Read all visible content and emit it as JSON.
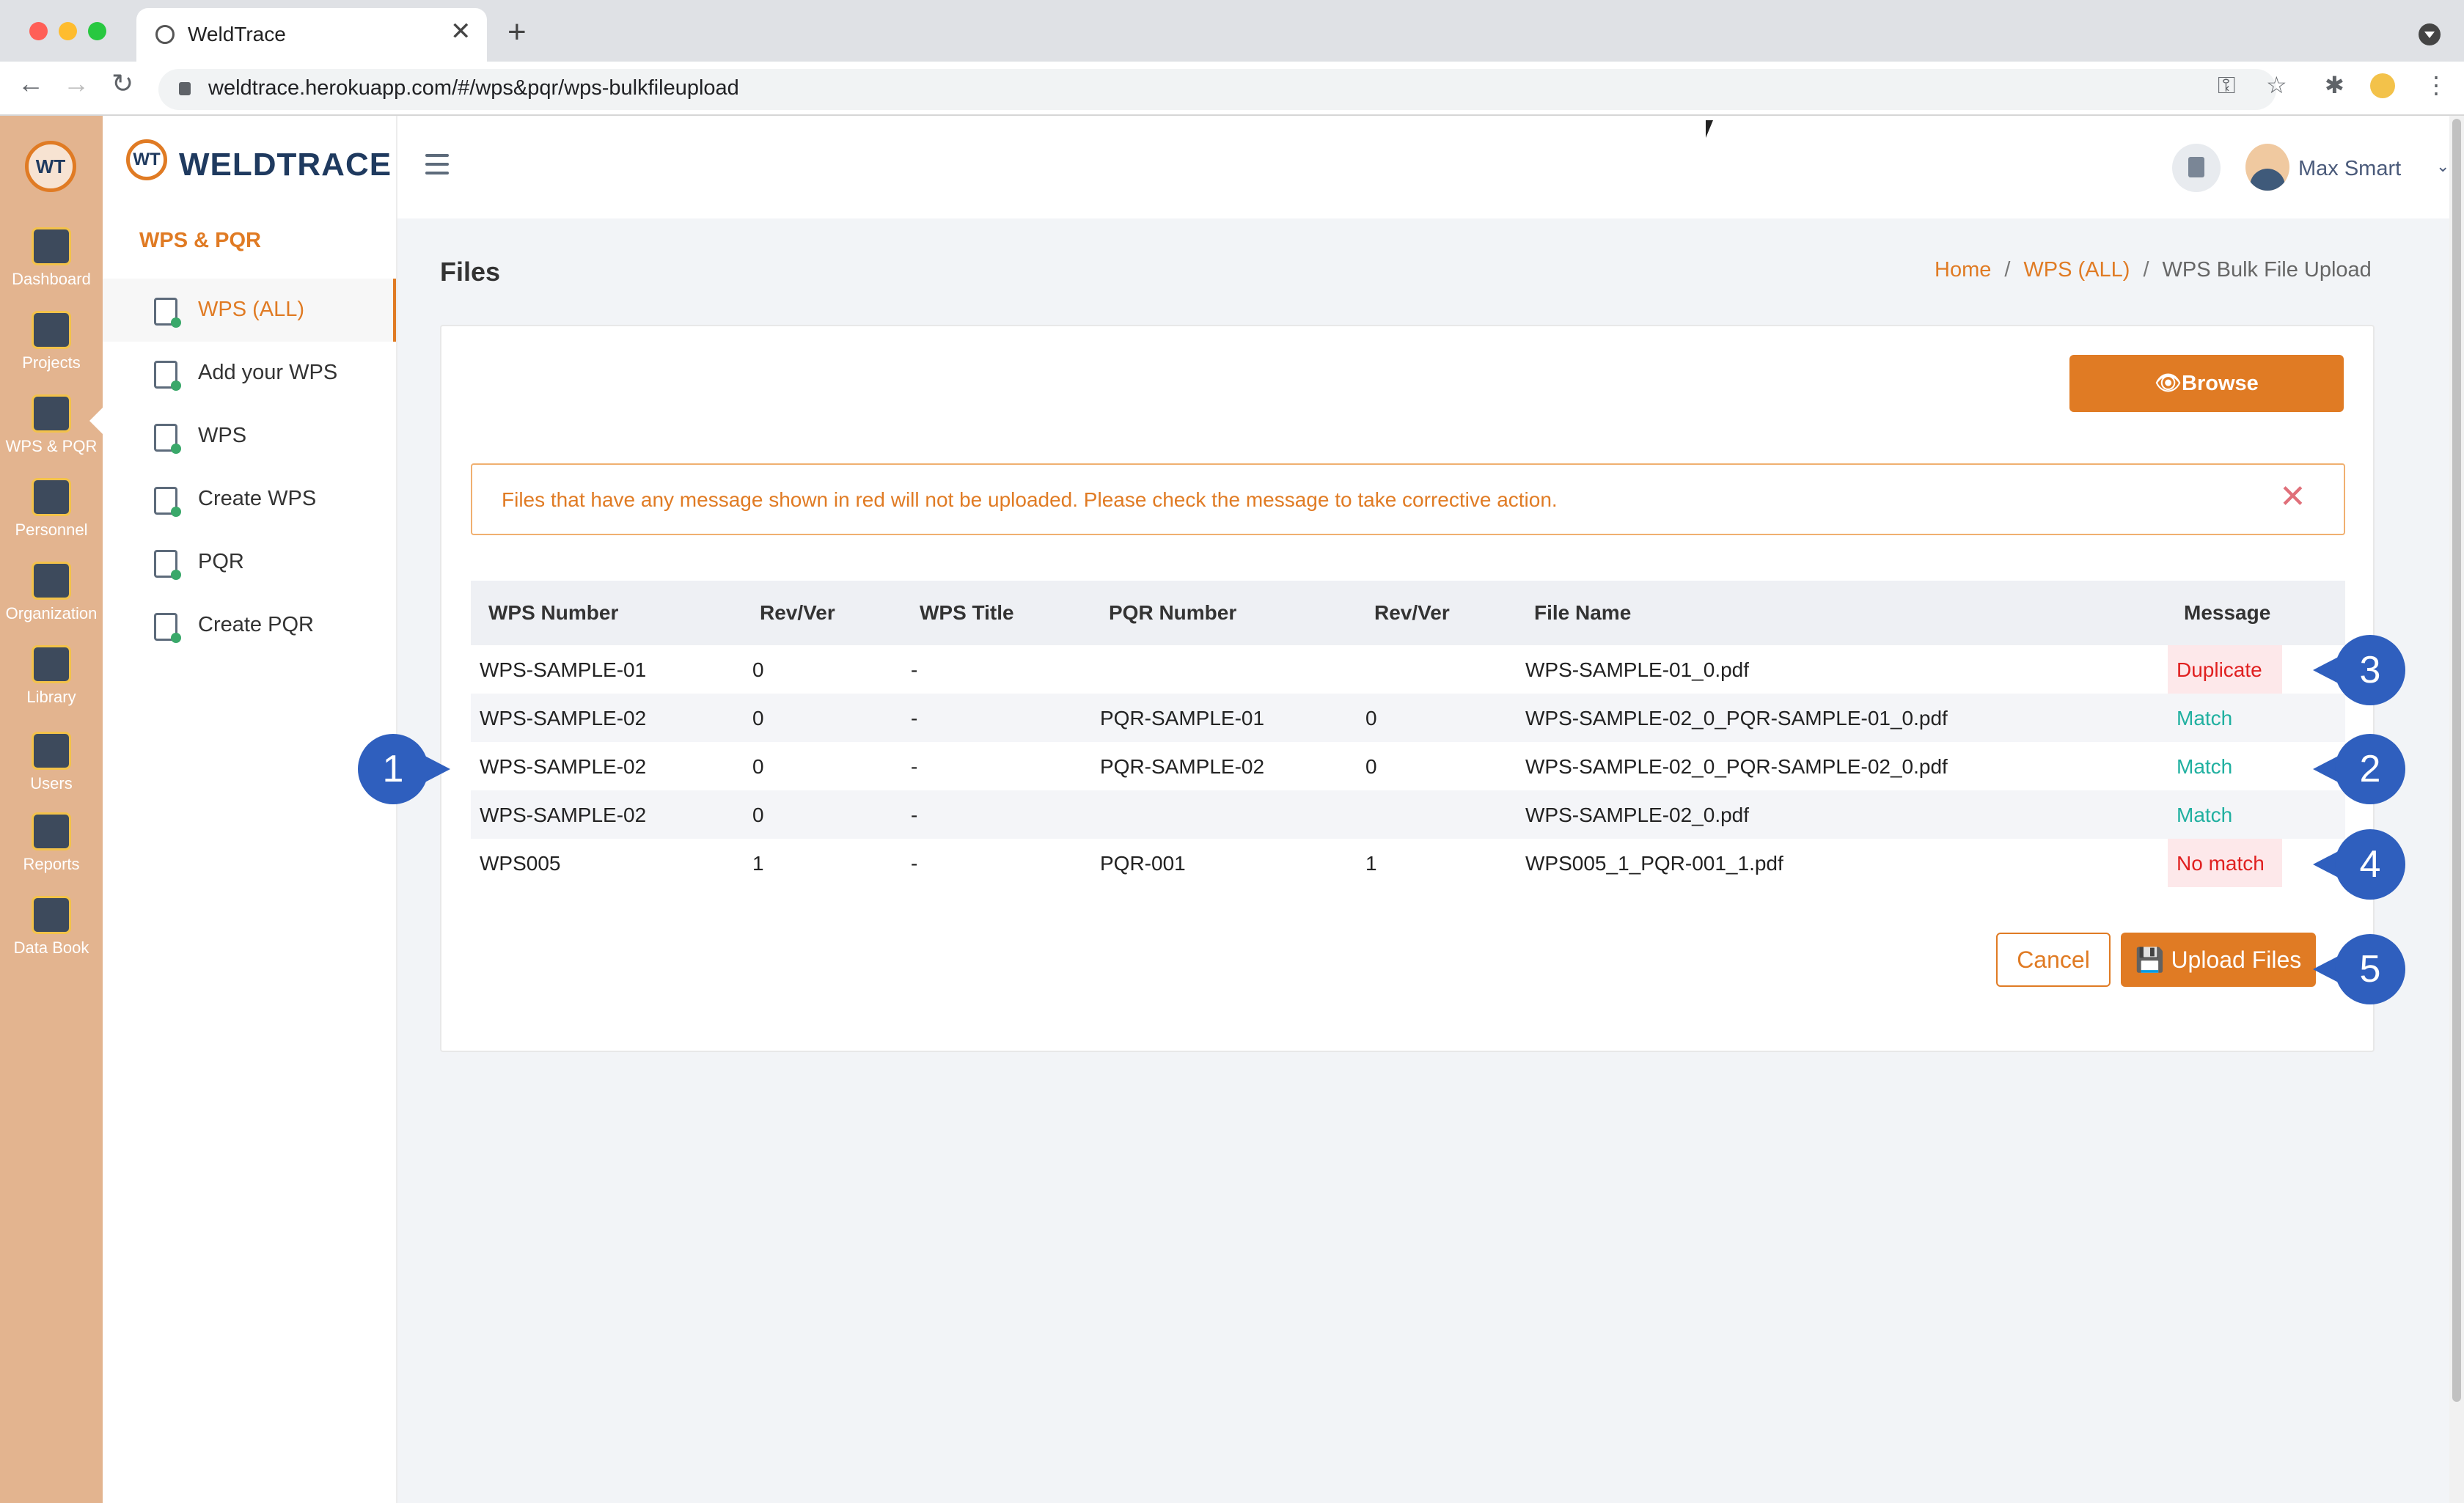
{
  "browser": {
    "tab_title": "WeldTrace",
    "tab_close": "✕",
    "new_tab": "+",
    "url": "weldtrace.herokuapp.com/#/wps&pqr/wps-bulkfileupload",
    "back": "←",
    "forward": "→",
    "reload": "↻",
    "key_icon": "⚿",
    "star_icon": "☆",
    "puzzle_icon": "✱",
    "menu_icon": "⋮"
  },
  "rail": {
    "logo": "WT",
    "items": [
      {
        "label": "Dashboard"
      },
      {
        "label": "Projects"
      },
      {
        "label": "WPS & PQR"
      },
      {
        "label": "Personnel"
      },
      {
        "label": "Organization"
      },
      {
        "label": "Library"
      },
      {
        "label": "Users"
      },
      {
        "label": "Reports"
      },
      {
        "label": "Data Book"
      }
    ]
  },
  "sidebar": {
    "brand_mark": "WT",
    "brand": "WELDTRACE",
    "section_title": "WPS & PQR",
    "items": [
      {
        "label": "WPS (ALL)"
      },
      {
        "label": "Add your WPS"
      },
      {
        "label": "WPS"
      },
      {
        "label": "Create WPS"
      },
      {
        "label": "PQR"
      },
      {
        "label": "Create PQR"
      }
    ]
  },
  "header": {
    "user_name": "Max Smart",
    "chevron": "⌄"
  },
  "page": {
    "title": "Files",
    "breadcrumb": {
      "home": "Home",
      "sep": "/",
      "parent": "WPS (ALL)",
      "current": "WPS Bulk File Upload"
    },
    "browse_label": "👁Browse",
    "alert_text": "Files that have any message shown in red will not be uploaded. Please check the message to take corrective action.",
    "alert_close": "✕",
    "cancel_label": "Cancel",
    "upload_label": "💾 Upload Files"
  },
  "table": {
    "headers": [
      "WPS Number",
      "Rev/Ver",
      "WPS Title",
      "PQR Number",
      "Rev/Ver",
      "File Name",
      "Message"
    ],
    "rows": [
      {
        "wps": "WPS-SAMPLE-01",
        "rev": "0",
        "title": "-",
        "pqr": "",
        "pqr_rev": "",
        "file": "WPS-SAMPLE-01_0.pdf",
        "message": "Duplicate",
        "status": "red"
      },
      {
        "wps": "WPS-SAMPLE-02",
        "rev": "0",
        "title": "-",
        "pqr": "PQR-SAMPLE-01",
        "pqr_rev": "0",
        "file": "WPS-SAMPLE-02_0_PQR-SAMPLE-01_0.pdf",
        "message": "Match",
        "status": "green"
      },
      {
        "wps": "WPS-SAMPLE-02",
        "rev": "0",
        "title": "-",
        "pqr": "PQR-SAMPLE-02",
        "pqr_rev": "0",
        "file": "WPS-SAMPLE-02_0_PQR-SAMPLE-02_0.pdf",
        "message": "Match",
        "status": "green"
      },
      {
        "wps": "WPS-SAMPLE-02",
        "rev": "0",
        "title": "-",
        "pqr": "",
        "pqr_rev": "",
        "file": "WPS-SAMPLE-02_0.pdf",
        "message": "Match",
        "status": "green"
      },
      {
        "wps": "WPS005",
        "rev": "1",
        "title": "-",
        "pqr": "PQR-001",
        "pqr_rev": "1",
        "file": "WPS005_1_PQR-001_1.pdf",
        "message": "No match",
        "status": "red"
      }
    ]
  },
  "callouts": [
    "1",
    "2",
    "3",
    "4",
    "5"
  ],
  "colors": {
    "accent": "#e07b24",
    "rail": "#e3b48f",
    "callout": "#2f5fbe",
    "error": "#e02020",
    "match": "#20b0a0"
  }
}
